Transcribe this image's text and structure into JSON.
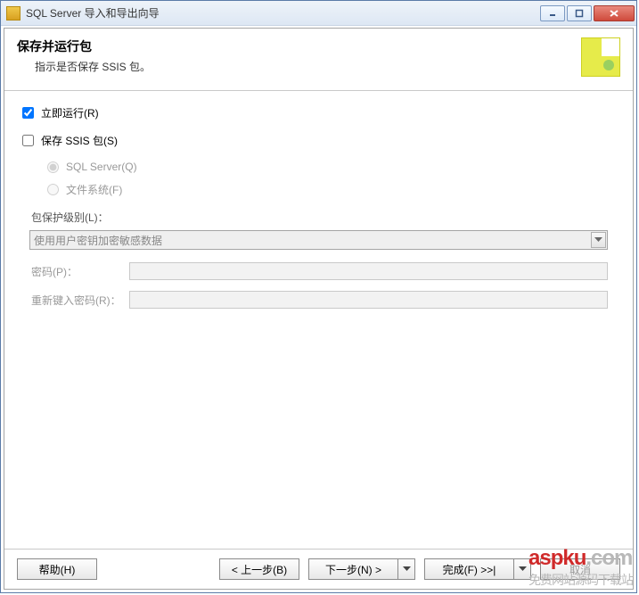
{
  "titlebar": {
    "title": "SQL Server 导入和导出向导"
  },
  "header": {
    "title": "保存并运行包",
    "subtitle": "指示是否保存 SSIS 包。"
  },
  "options": {
    "run_now_label": "立即运行(R)",
    "save_ssis_label": "保存 SSIS 包(S)",
    "radio_sqlserver": "SQL Server(Q)",
    "radio_filesystem": "文件系统(F)"
  },
  "protection": {
    "level_label": "包保护级别(L)：",
    "level_value": "使用用户密钥加密敏感数据",
    "password_label": "密码(P)：",
    "retype_label": "重新键入密码(R)："
  },
  "buttons": {
    "help": "帮助(H)",
    "back": "< 上一步(B)",
    "next": "下一步(N) >",
    "finish": "完成(F) >>|",
    "cancel": "取消"
  },
  "watermark": {
    "main": "aspku",
    "sub": ".com",
    "tag": "免费网站源码下载站"
  }
}
